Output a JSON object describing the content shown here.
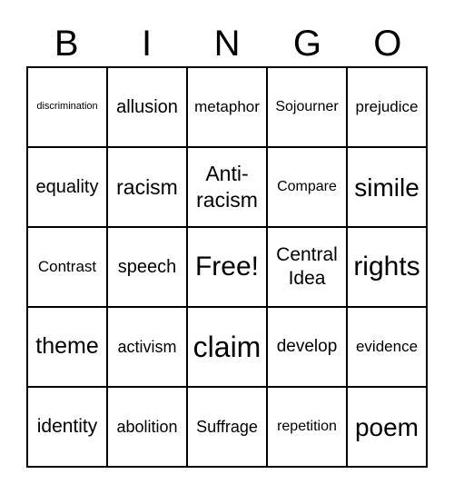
{
  "header": [
    "B",
    "I",
    "N",
    "G",
    "O"
  ],
  "cells": [
    "discrimination",
    "allusion",
    "metaphor",
    "Sojourner",
    "prejudice",
    "equality",
    "racism",
    "Anti-racism",
    "Compare",
    "simile",
    "Contrast",
    "speech",
    "Free!",
    "Central Idea",
    "rights",
    "theme",
    "activism",
    "claim",
    "develop",
    "evidence",
    "identity",
    "abolition",
    "Suffrage",
    "repetition",
    "poem"
  ]
}
